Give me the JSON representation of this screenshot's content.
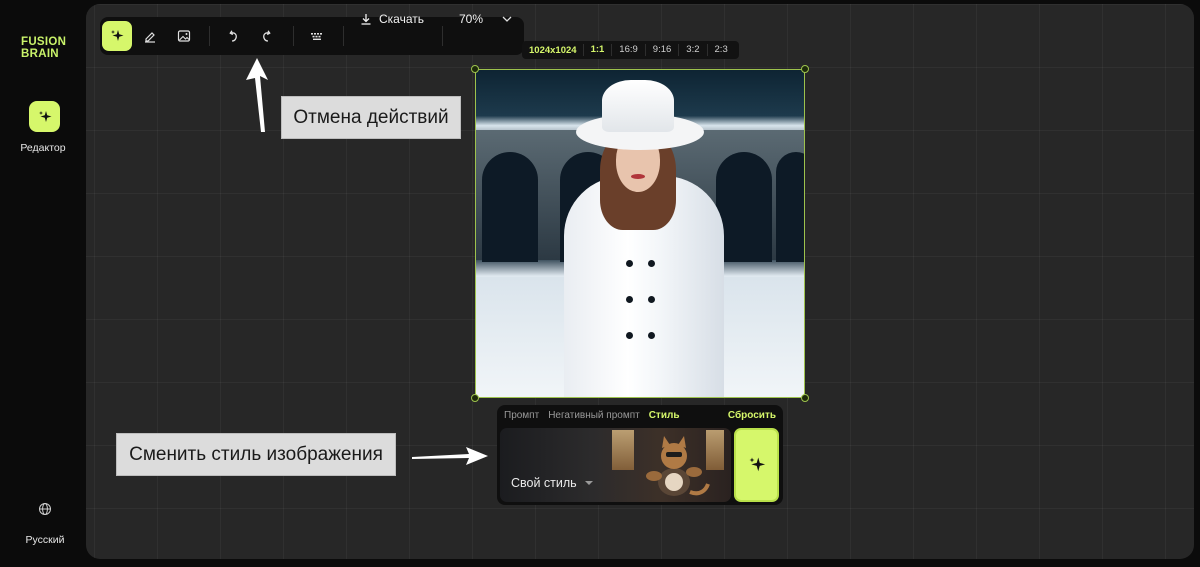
{
  "app": {
    "logo_line1": "FUSION",
    "logo_line2": "BRAIN",
    "accent": "#d6f76b"
  },
  "sidebar": {
    "editor_label": "Редактор",
    "editor_icon": "sparkle-icon",
    "language_icon": "globe-icon",
    "language_label": "Русский"
  },
  "toolbar": {
    "tools": [
      {
        "name": "generate",
        "icon": "sparkle-icon",
        "active": true
      },
      {
        "name": "eraser",
        "icon": "eraser-icon",
        "active": false
      },
      {
        "name": "image",
        "icon": "image-icon",
        "active": false
      },
      {
        "name": "undo",
        "icon": "undo-icon",
        "active": false
      },
      {
        "name": "redo",
        "icon": "redo-icon",
        "active": false
      },
      {
        "name": "keyboard",
        "icon": "keyboard-icon",
        "active": false
      }
    ],
    "download_label": "Скачать",
    "zoom": "70%"
  },
  "ratio_bar": {
    "size": "1024x1024",
    "options": [
      "1:1",
      "16:9",
      "9:16",
      "3:2",
      "2:3"
    ],
    "selected": "1:1"
  },
  "annotations": {
    "undo_callout": "Отмена действий",
    "style_callout": "Сменить стиль изображения"
  },
  "panel": {
    "tabs": [
      "Промпт",
      "Негативный промпт",
      "Стиль"
    ],
    "active_tab": "Стиль",
    "reset_label": "Сбросить",
    "style_name": "Свой стиль",
    "generate_icon": "sparkle-icon"
  }
}
